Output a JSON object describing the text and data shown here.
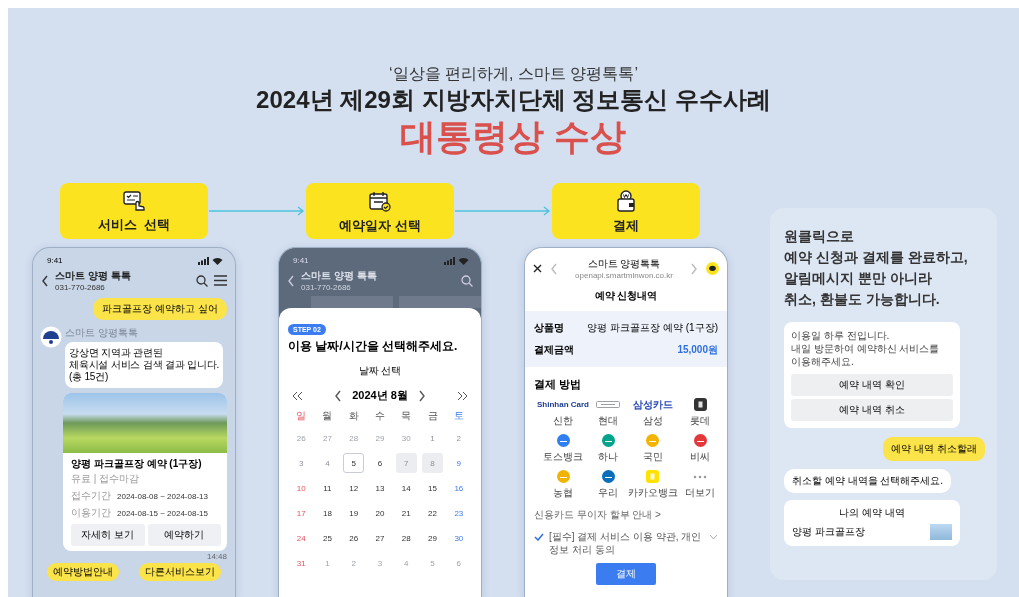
{
  "header": {
    "tagline": "‘일상을 편리하게, 스마트 양평톡톡’",
    "title": "2024년 제29회 지방자치단체 정보통신 우수사례",
    "award": "대통령상 수상"
  },
  "steps": [
    {
      "label": "서비스  선택",
      "kind": "service"
    },
    {
      "label": "예약일자 선택",
      "kind": "date"
    },
    {
      "label": "결제",
      "kind": "payment"
    }
  ],
  "chat_phone": {
    "time": "9:41",
    "title": "스마트 양평 톡톡",
    "phone": "031-770-2686",
    "user_message": "파크골프장 예약하고 싶어",
    "bot_name": "스마트 양평톡톡",
    "bot_message": "강상면 지역과 관련된\n체육시설 서비스 검색 결과 입니다.\n(총 15건)",
    "card": {
      "title": "양평 파크골프장 예약 (1구장)",
      "subtitle": "유료 | 접수마감",
      "rows": [
        {
          "label": "접수기간",
          "value": "2024-08-08 ~ 2024-08-13"
        },
        {
          "label": "이용기간",
          "value": "2024-08-15 ~ 2024-08-15"
        }
      ],
      "buttons": [
        "자세히 보기",
        "예약하기"
      ]
    },
    "sent_time": "14:48",
    "quick_replies": [
      "예약방법안내",
      "다른서비스보기"
    ]
  },
  "calendar_phone": {
    "time": "9:41",
    "title": "스마트 양평 톡톡",
    "phone": "031-770-2686",
    "step": "STEP 02",
    "heading": "이용 날짜/시간을 선택해주세요.",
    "subheading": "날짜 선택",
    "month": "2024년 8월",
    "weekdays": [
      "일",
      "월",
      "화",
      "수",
      "목",
      "금",
      "토"
    ],
    "weeks": [
      [
        {
          "d": "26",
          "kind": "outside",
          "selected": false
        },
        {
          "d": "27",
          "kind": "outside",
          "selected": false
        },
        {
          "d": "28",
          "kind": "outside",
          "selected": false
        },
        {
          "d": "29",
          "kind": "outside",
          "selected": false
        },
        {
          "d": "30",
          "kind": "outside",
          "selected": false
        },
        {
          "d": "1",
          "kind": "past",
          "selected": false
        },
        {
          "d": "2",
          "kind": "past",
          "selected": false
        }
      ],
      [
        {
          "d": "3",
          "kind": "past",
          "selected": false
        },
        {
          "d": "4",
          "kind": "past",
          "selected": false
        },
        {
          "d": "5",
          "kind": "normal",
          "selected": true
        },
        {
          "d": "6",
          "kind": "normal",
          "selected": false
        },
        {
          "d": "7",
          "kind": "blocked",
          "selected": false
        },
        {
          "d": "8",
          "kind": "blocked",
          "selected": false
        },
        {
          "d": "9",
          "kind": "normal",
          "selected": false
        }
      ],
      [
        {
          "d": "10",
          "kind": "normal",
          "selected": false
        },
        {
          "d": "11",
          "kind": "normal",
          "selected": false
        },
        {
          "d": "12",
          "kind": "normal",
          "selected": false
        },
        {
          "d": "13",
          "kind": "normal",
          "selected": false
        },
        {
          "d": "14",
          "kind": "normal",
          "selected": false
        },
        {
          "d": "15",
          "kind": "normal",
          "selected": false
        },
        {
          "d": "16",
          "kind": "normal",
          "selected": false
        }
      ],
      [
        {
          "d": "17",
          "kind": "normal",
          "selected": false
        },
        {
          "d": "18",
          "kind": "normal",
          "selected": false
        },
        {
          "d": "19",
          "kind": "normal",
          "selected": false
        },
        {
          "d": "20",
          "kind": "normal",
          "selected": false
        },
        {
          "d": "21",
          "kind": "normal",
          "selected": false
        },
        {
          "d": "22",
          "kind": "normal",
          "selected": false
        },
        {
          "d": "23",
          "kind": "normal",
          "selected": false
        }
      ],
      [
        {
          "d": "24",
          "kind": "normal",
          "selected": false
        },
        {
          "d": "25",
          "kind": "normal",
          "selected": false
        },
        {
          "d": "26",
          "kind": "normal",
          "selected": false
        },
        {
          "d": "27",
          "kind": "normal",
          "selected": false
        },
        {
          "d": "28",
          "kind": "normal",
          "selected": false
        },
        {
          "d": "29",
          "kind": "normal",
          "selected": false
        },
        {
          "d": "30",
          "kind": "normal",
          "selected": false
        }
      ],
      [
        {
          "d": "31",
          "kind": "normal",
          "selected": false
        },
        {
          "d": "1",
          "kind": "outside",
          "selected": false
        },
        {
          "d": "2",
          "kind": "outside",
          "selected": false
        },
        {
          "d": "3",
          "kind": "outside",
          "selected": false
        },
        {
          "d": "4",
          "kind": "outside",
          "selected": false
        },
        {
          "d": "5",
          "kind": "outside",
          "selected": false
        },
        {
          "d": "6",
          "kind": "outside",
          "selected": false
        }
      ]
    ]
  },
  "payment_phone": {
    "title": "스마트 양평톡톡",
    "url": "openapi.smartminwon.co.kr",
    "heading": "예약 신청내역",
    "details": [
      {
        "label": "상품명",
        "value": "양평 파크골프장 예약 (1구장)",
        "kind": "plain"
      },
      {
        "label": "결제금액",
        "value": "15,000원",
        "kind": "amount"
      }
    ],
    "methods_heading": "결제 방법",
    "methods": [
      {
        "name": "신한",
        "kind": "text-logo",
        "logo_text": "Shinhan Card",
        "color": "#1b3c8f"
      },
      {
        "name": "현대",
        "kind": "outlined",
        "color": "#9aa0a6"
      },
      {
        "name": "삼성",
        "kind": "text-logo",
        "logo_text": "삼성카드",
        "color": "#2446b8"
      },
      {
        "name": "롯데",
        "kind": "square",
        "color": "#333333"
      },
      {
        "name": "토스뱅크",
        "kind": "circle",
        "color": "#2f7ff0"
      },
      {
        "name": "하나",
        "kind": "circle",
        "color": "#00a48c"
      },
      {
        "name": "국민",
        "kind": "circle",
        "color": "#f2b400"
      },
      {
        "name": "비씨",
        "kind": "circle",
        "color": "#e5383b"
      },
      {
        "name": "농협",
        "kind": "circle",
        "color": "#f0b400"
      },
      {
        "name": "우리",
        "kind": "circle",
        "color": "#0a6fb8"
      },
      {
        "name": "카카오뱅크",
        "kind": "square",
        "color": "#ffe200"
      },
      {
        "name": "더보기",
        "kind": "more"
      }
    ],
    "installment": "신용카드 무이자 할부 안내 >",
    "agreement": {
      "text": "[필수] 결제 서비스 이용 약관, 개인정보 처리 동의",
      "checked": true
    },
    "pay_button": "결제"
  },
  "summary": {
    "heading": "원클릭으로\n예약 신청과 결제를 완료하고,\n알림메시지 뿐만 아니라\n취소, 환불도 가능합니다.",
    "reminder": "이용일 하루 전입니다.\n내일 방문하여 예약하신 서비스를\n이용해주세요.",
    "reminder_buttons": [
      "예약 내역 확인",
      "예약 내역 취소"
    ],
    "user_message": "예약 내역 취소할래",
    "bot_message": "취소할 예약 내역을 선택해주세요.",
    "list_title": "나의 예약 내역",
    "list_item": "양평 파크골프장"
  }
}
